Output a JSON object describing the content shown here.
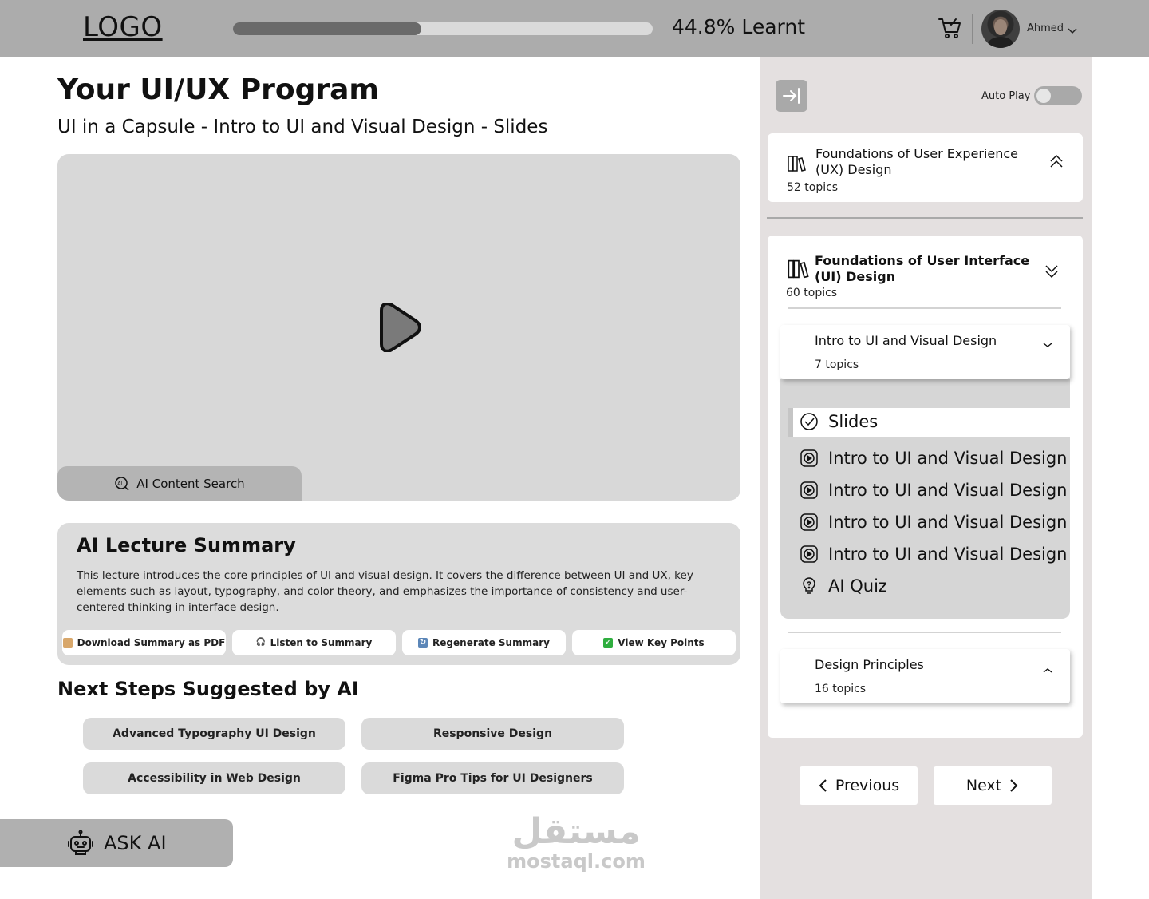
{
  "header": {
    "logo": "LOGO",
    "progress_percent": 44.8,
    "progress_label": "44.8% Learnt",
    "user_name": "Ahmed"
  },
  "main": {
    "title": "Your UI/UX Program",
    "subtitle": "UI in a Capsule - Intro to UI and Visual Design - Slides",
    "ai_search_label": "AI Content Search",
    "summary": {
      "title": "AI Lecture Summary",
      "text": "This lecture introduces the core principles of UI and visual design. It covers the difference between UI and UX, key elements such as layout, typography, and color theory, and emphasizes the importance of consistency and user-centered thinking in interface design.",
      "actions": [
        {
          "label": "Download Summary as PDF",
          "icon": "pdf-icon"
        },
        {
          "label": "Listen to Summary",
          "icon": "headphones-icon"
        },
        {
          "label": "Regenerate Summary",
          "icon": "refresh-icon"
        },
        {
          "label": "View Key Points",
          "icon": "check-icon"
        }
      ]
    },
    "next_steps_title": "Next Steps Suggested by AI",
    "suggestions": [
      "Advanced Typography UI Design",
      "Responsive Design",
      "Accessibility in Web Design",
      "Figma Pro Tips for UI Designers"
    ],
    "ask_ai_label": "ASK AI"
  },
  "watermark": {
    "arabic": "مستقل",
    "latin": "mostaql.com"
  },
  "sidebar": {
    "autoplay_label": "Auto Play",
    "autoplay_on": false,
    "courses": [
      {
        "title": "Foundations of User Experience (UX) Design",
        "topics": "52 topics",
        "expanded": false
      },
      {
        "title": "Foundations of User Interface (UI) Design",
        "topics": "60 topics",
        "expanded": true
      }
    ],
    "modules": [
      {
        "title": "Intro to UI and Visual Design",
        "topics": "7 topics"
      },
      {
        "title": "Design Principles",
        "topics": "16 topics"
      }
    ],
    "lessons": [
      {
        "label": "Slides",
        "icon": "check-circle-icon",
        "active": true
      },
      {
        "label": "Intro to UI and Visual Design",
        "icon": "video-icon"
      },
      {
        "label": "Intro to UI and Visual Design",
        "icon": "video-icon"
      },
      {
        "label": "Intro to UI and Visual Design",
        "icon": "video-icon"
      },
      {
        "label": "Intro to UI and Visual Design",
        "icon": "video-icon"
      },
      {
        "label": "AI Quiz",
        "icon": "lightbulb-icon"
      }
    ],
    "previous_label": "Previous",
    "next_label": "Next"
  },
  "colors": {
    "header_bg": "#acacac",
    "progress_fill": "#6a6a6a",
    "sidebar_bg": "#e4e0e0",
    "card_bg": "#ffffff",
    "panel_bg": "#d6d6d6"
  }
}
